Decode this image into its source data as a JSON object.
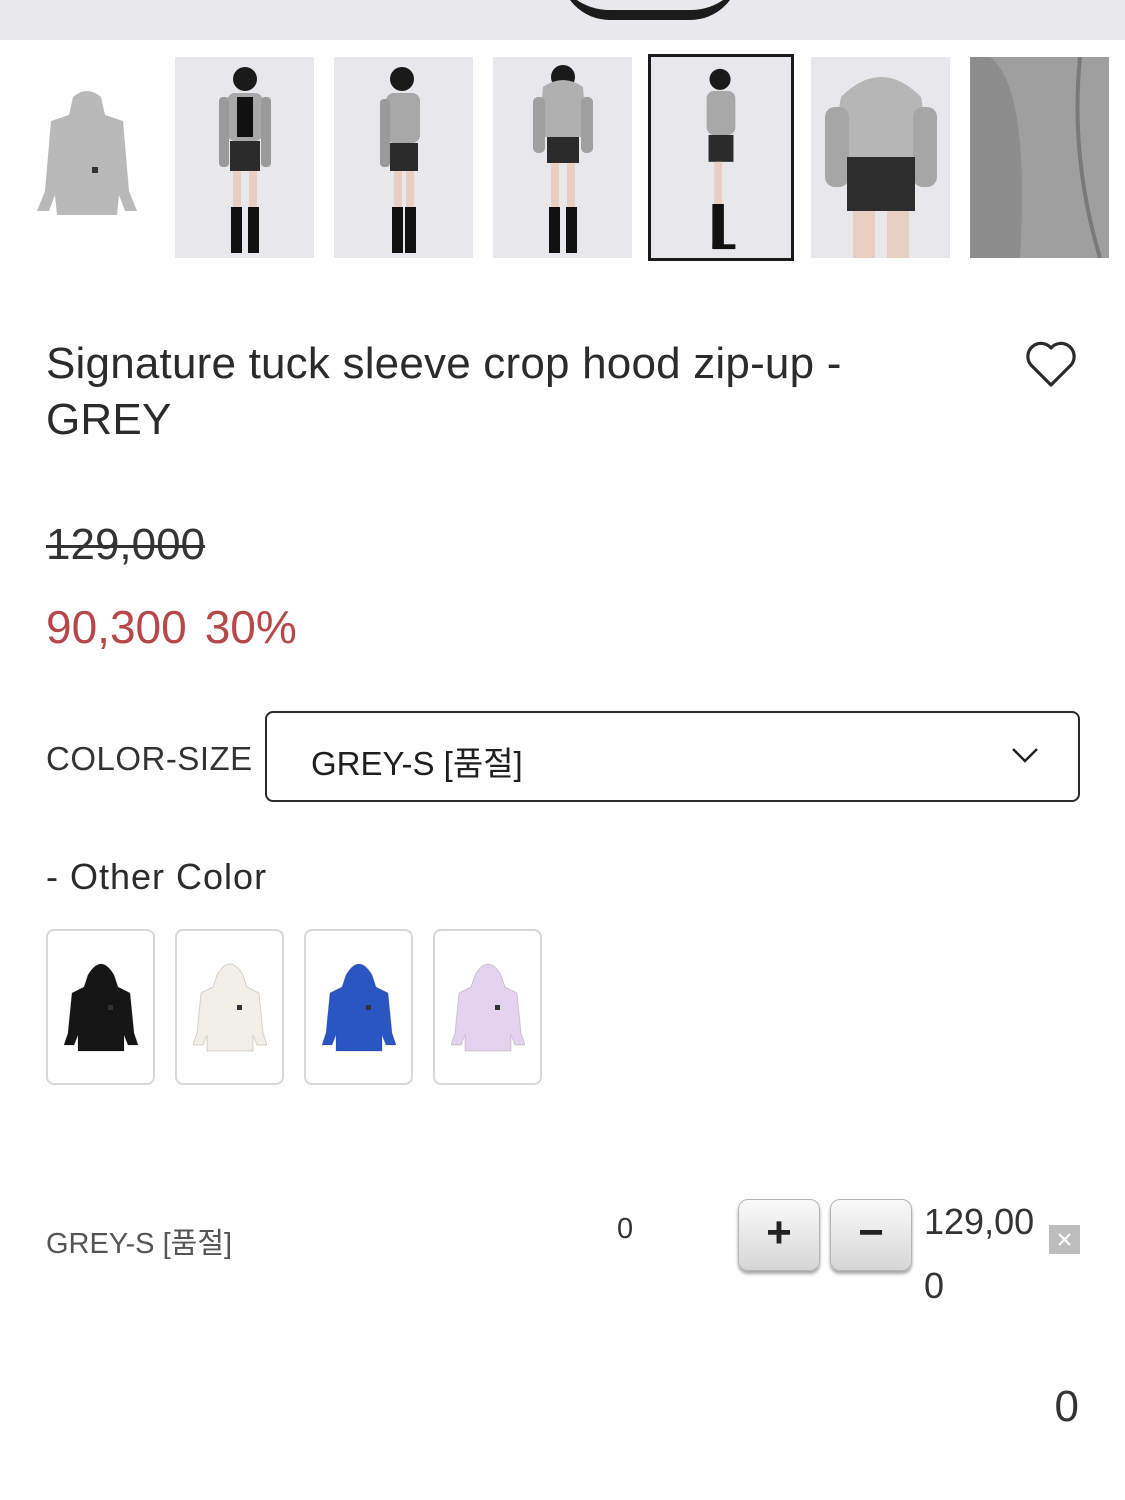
{
  "hero": {
    "alt": "product photo (top, cropped)"
  },
  "thumbnails": [
    {
      "name": "flat-lay"
    },
    {
      "name": "model-front"
    },
    {
      "name": "model-side-front"
    },
    {
      "name": "model-back"
    },
    {
      "name": "model-side",
      "active": true
    },
    {
      "name": "model-back-closeup"
    },
    {
      "name": "sleeve-detail"
    }
  ],
  "product": {
    "title": "Signature tuck sleeve crop hood zip-up - GREY",
    "original_price": "129,000",
    "sale_price": "90,300",
    "discount": "30%"
  },
  "option": {
    "label": "COLOR-SIZE",
    "selected": "GREY-S [품절]"
  },
  "other_color": {
    "title": "- Other Color",
    "swatches": [
      {
        "name": "black",
        "color": "#151515"
      },
      {
        "name": "white",
        "color": "#f2efe6"
      },
      {
        "name": "blue",
        "color": "#2a56c4"
      },
      {
        "name": "lavender",
        "color": "#e4d3ef"
      }
    ]
  },
  "selected_line": {
    "name": "GREY-S [품절]",
    "quantity": "0",
    "plus": "+",
    "minus": "−",
    "price": "129,000"
  },
  "total": "0",
  "colors": {
    "sale": "#b6484a",
    "border": "#2a2a2a"
  }
}
